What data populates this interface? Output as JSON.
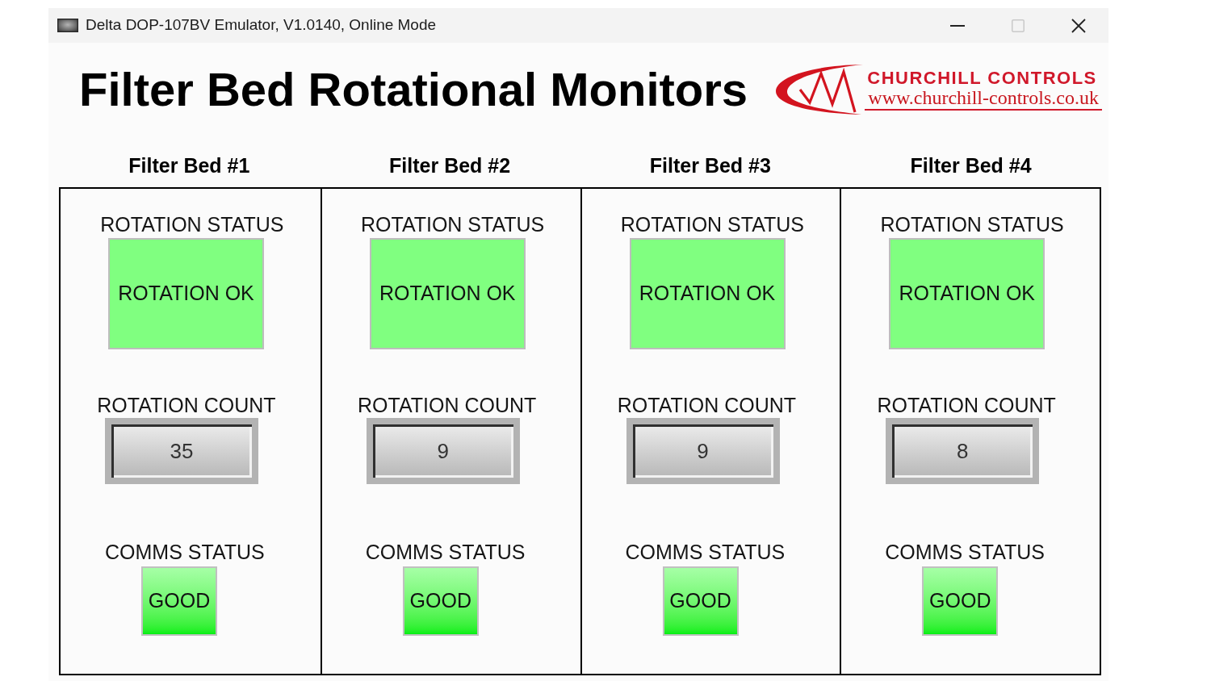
{
  "window": {
    "title": "Delta DOP-107BV Emulator, V1.0140, Online Mode",
    "controls": [
      {
        "kind": "minimize",
        "disabled": false
      },
      {
        "kind": "maximize",
        "disabled": true
      },
      {
        "kind": "close",
        "disabled": false
      }
    ]
  },
  "header": {
    "title": "Filter Bed Rotational Monitors",
    "logo": {
      "name": "CHURCHILL CONTROLS",
      "url": "www.churchill-controls.co.uk"
    }
  },
  "filter_beds": [
    {
      "heading": "Filter Bed #1",
      "rotation_status": {
        "label": "ROTATION STATUS",
        "value": "ROTATION OK"
      },
      "rotation_count": {
        "label": "ROTATION COUNT",
        "value": "35"
      },
      "comms_status": {
        "label": "COMMS STATUS",
        "value": "GOOD"
      }
    },
    {
      "heading": "Filter Bed #2",
      "rotation_status": {
        "label": "ROTATION STATUS",
        "value": "ROTATION OK"
      },
      "rotation_count": {
        "label": "ROTATION COUNT",
        "value": "9"
      },
      "comms_status": {
        "label": "COMMS STATUS",
        "value": "GOOD"
      }
    },
    {
      "heading": "Filter Bed #3",
      "rotation_status": {
        "label": "ROTATION STATUS",
        "value": "ROTATION OK"
      },
      "rotation_count": {
        "label": "ROTATION COUNT",
        "value": "9"
      },
      "comms_status": {
        "label": "COMMS STATUS",
        "value": "GOOD"
      }
    },
    {
      "heading": "Filter Bed #4",
      "rotation_status": {
        "label": "ROTATION STATUS",
        "value": "ROTATION OK"
      },
      "rotation_count": {
        "label": "ROTATION COUNT",
        "value": "8"
      },
      "comms_status": {
        "label": "COMMS STATUS",
        "value": "GOOD"
      }
    }
  ]
}
